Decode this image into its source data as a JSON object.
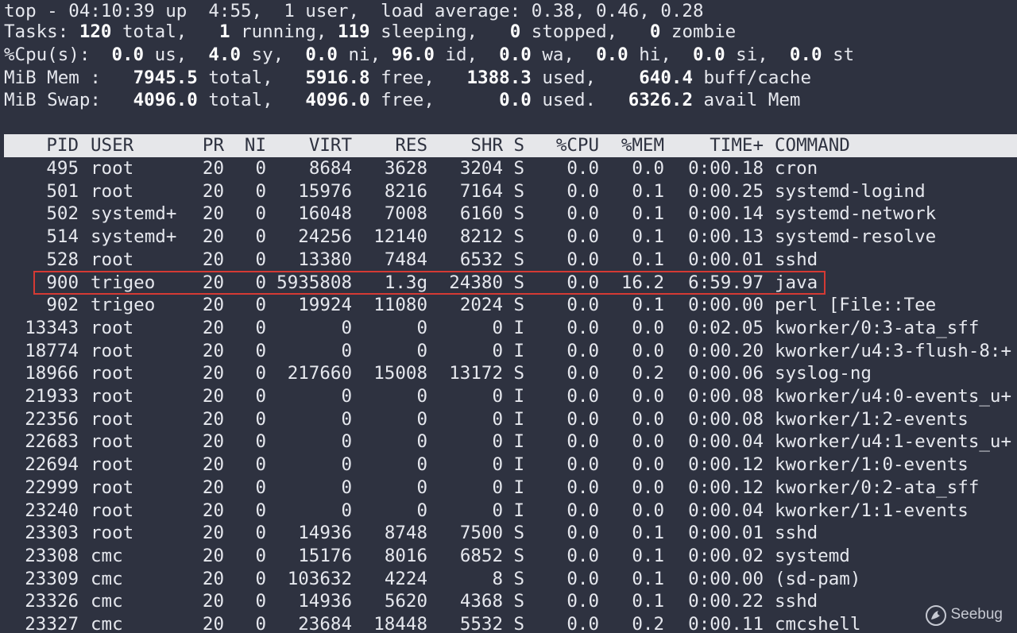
{
  "summary": {
    "line1": "top - 04:10:39 up  4:55,  1 user,  load average: 0.38, 0.46, 0.28",
    "tasks": {
      "label": "Tasks:",
      "total": "120",
      "total_label": "total,",
      "running": "1",
      "running_label": "running,",
      "sleeping": "119",
      "sleeping_label": "sleeping,",
      "stopped": "0",
      "stopped_label": "stopped,",
      "zombie": "0",
      "zombie_label": "zombie"
    },
    "cpu": {
      "label": "%Cpu(s):",
      "us": "0.0",
      "sy": "4.0",
      "ni": "0.0",
      "id": "96.0",
      "wa": "0.0",
      "hi": "0.0",
      "si": "0.0",
      "st": "0.0"
    },
    "mem": {
      "label": "MiB Mem :",
      "total": "7945.5",
      "free": "5916.8",
      "used": "1388.3",
      "buff": "640.4",
      "buff_label": "buff/cache"
    },
    "swap": {
      "label": "MiB Swap:",
      "total": "4096.0",
      "free": "4096.0",
      "used": "0.0",
      "avail": "6326.2",
      "avail_label": "avail Mem"
    }
  },
  "columns": [
    "PID",
    "USER",
    "PR",
    "NI",
    "VIRT",
    "RES",
    "SHR",
    "S",
    "%CPU",
    "%MEM",
    "TIME+",
    "COMMAND"
  ],
  "processes": [
    {
      "pid": "495",
      "user": "root",
      "pr": "20",
      "ni": "0",
      "virt": "8684",
      "res": "3628",
      "shr": "3204",
      "s": "S",
      "cpu": "0.0",
      "mem": "0.0",
      "time": "0:00.18",
      "cmd": "cron"
    },
    {
      "pid": "501",
      "user": "root",
      "pr": "20",
      "ni": "0",
      "virt": "15976",
      "res": "8216",
      "shr": "7164",
      "s": "S",
      "cpu": "0.0",
      "mem": "0.1",
      "time": "0:00.25",
      "cmd": "systemd-logind"
    },
    {
      "pid": "502",
      "user": "systemd+",
      "pr": "20",
      "ni": "0",
      "virt": "16048",
      "res": "7008",
      "shr": "6160",
      "s": "S",
      "cpu": "0.0",
      "mem": "0.1",
      "time": "0:00.14",
      "cmd": "systemd-network"
    },
    {
      "pid": "514",
      "user": "systemd+",
      "pr": "20",
      "ni": "0",
      "virt": "24256",
      "res": "12140",
      "shr": "8212",
      "s": "S",
      "cpu": "0.0",
      "mem": "0.1",
      "time": "0:00.13",
      "cmd": "systemd-resolve"
    },
    {
      "pid": "528",
      "user": "root",
      "pr": "20",
      "ni": "0",
      "virt": "13380",
      "res": "7484",
      "shr": "6532",
      "s": "S",
      "cpu": "0.0",
      "mem": "0.1",
      "time": "0:00.01",
      "cmd": "sshd"
    },
    {
      "pid": "900",
      "user": "trigeo",
      "pr": "20",
      "ni": "0",
      "virt": "5935808",
      "res": "1.3g",
      "shr": "24380",
      "s": "S",
      "cpu": "0.0",
      "mem": "16.2",
      "time": "6:59.97",
      "cmd": "java"
    },
    {
      "pid": "902",
      "user": "trigeo",
      "pr": "20",
      "ni": "0",
      "virt": "19924",
      "res": "11080",
      "shr": "2024",
      "s": "S",
      "cpu": "0.0",
      "mem": "0.1",
      "time": "0:00.00",
      "cmd": "perl [File::Tee"
    },
    {
      "pid": "13343",
      "user": "root",
      "pr": "20",
      "ni": "0",
      "virt": "0",
      "res": "0",
      "shr": "0",
      "s": "I",
      "cpu": "0.0",
      "mem": "0.0",
      "time": "0:02.05",
      "cmd": "kworker/0:3-ata_sff"
    },
    {
      "pid": "18774",
      "user": "root",
      "pr": "20",
      "ni": "0",
      "virt": "0",
      "res": "0",
      "shr": "0",
      "s": "I",
      "cpu": "0.0",
      "mem": "0.0",
      "time": "0:00.20",
      "cmd": "kworker/u4:3-flush-8:+"
    },
    {
      "pid": "18966",
      "user": "root",
      "pr": "20",
      "ni": "0",
      "virt": "217660",
      "res": "15008",
      "shr": "13172",
      "s": "S",
      "cpu": "0.0",
      "mem": "0.2",
      "time": "0:00.06",
      "cmd": "syslog-ng"
    },
    {
      "pid": "21933",
      "user": "root",
      "pr": "20",
      "ni": "0",
      "virt": "0",
      "res": "0",
      "shr": "0",
      "s": "I",
      "cpu": "0.0",
      "mem": "0.0",
      "time": "0:00.08",
      "cmd": "kworker/u4:0-events_u+"
    },
    {
      "pid": "22356",
      "user": "root",
      "pr": "20",
      "ni": "0",
      "virt": "0",
      "res": "0",
      "shr": "0",
      "s": "I",
      "cpu": "0.0",
      "mem": "0.0",
      "time": "0:00.08",
      "cmd": "kworker/1:2-events"
    },
    {
      "pid": "22683",
      "user": "root",
      "pr": "20",
      "ni": "0",
      "virt": "0",
      "res": "0",
      "shr": "0",
      "s": "I",
      "cpu": "0.0",
      "mem": "0.0",
      "time": "0:00.04",
      "cmd": "kworker/u4:1-events_u+"
    },
    {
      "pid": "22694",
      "user": "root",
      "pr": "20",
      "ni": "0",
      "virt": "0",
      "res": "0",
      "shr": "0",
      "s": "I",
      "cpu": "0.0",
      "mem": "0.0",
      "time": "0:00.12",
      "cmd": "kworker/1:0-events"
    },
    {
      "pid": "22999",
      "user": "root",
      "pr": "20",
      "ni": "0",
      "virt": "0",
      "res": "0",
      "shr": "0",
      "s": "I",
      "cpu": "0.0",
      "mem": "0.0",
      "time": "0:00.12",
      "cmd": "kworker/0:2-ata_sff"
    },
    {
      "pid": "23240",
      "user": "root",
      "pr": "20",
      "ni": "0",
      "virt": "0",
      "res": "0",
      "shr": "0",
      "s": "I",
      "cpu": "0.0",
      "mem": "0.0",
      "time": "0:00.04",
      "cmd": "kworker/1:1-events"
    },
    {
      "pid": "23303",
      "user": "root",
      "pr": "20",
      "ni": "0",
      "virt": "14936",
      "res": "8748",
      "shr": "7500",
      "s": "S",
      "cpu": "0.0",
      "mem": "0.1",
      "time": "0:00.01",
      "cmd": "sshd"
    },
    {
      "pid": "23308",
      "user": "cmc",
      "pr": "20",
      "ni": "0",
      "virt": "15176",
      "res": "8016",
      "shr": "6852",
      "s": "S",
      "cpu": "0.0",
      "mem": "0.1",
      "time": "0:00.02",
      "cmd": "systemd"
    },
    {
      "pid": "23309",
      "user": "cmc",
      "pr": "20",
      "ni": "0",
      "virt": "103632",
      "res": "4224",
      "shr": "8",
      "s": "S",
      "cpu": "0.0",
      "mem": "0.1",
      "time": "0:00.00",
      "cmd": "(sd-pam)"
    },
    {
      "pid": "23326",
      "user": "cmc",
      "pr": "20",
      "ni": "0",
      "virt": "14936",
      "res": "5620",
      "shr": "4368",
      "s": "S",
      "cpu": "0.0",
      "mem": "0.1",
      "time": "0:00.22",
      "cmd": "sshd"
    },
    {
      "pid": "23327",
      "user": "cmc",
      "pr": "20",
      "ni": "0",
      "virt": "23684",
      "res": "18448",
      "shr": "5532",
      "s": "S",
      "cpu": "0.0",
      "mem": "0.2",
      "time": "0:00.11",
      "cmd": "cmcshell"
    }
  ],
  "highlighted_pid": "900",
  "watermark": "Seebug",
  "colors": {
    "background": "#2e3240",
    "text": "#e6e8ee",
    "header_bar": "#e6e7ea",
    "highlight_border": "#d43a34"
  }
}
